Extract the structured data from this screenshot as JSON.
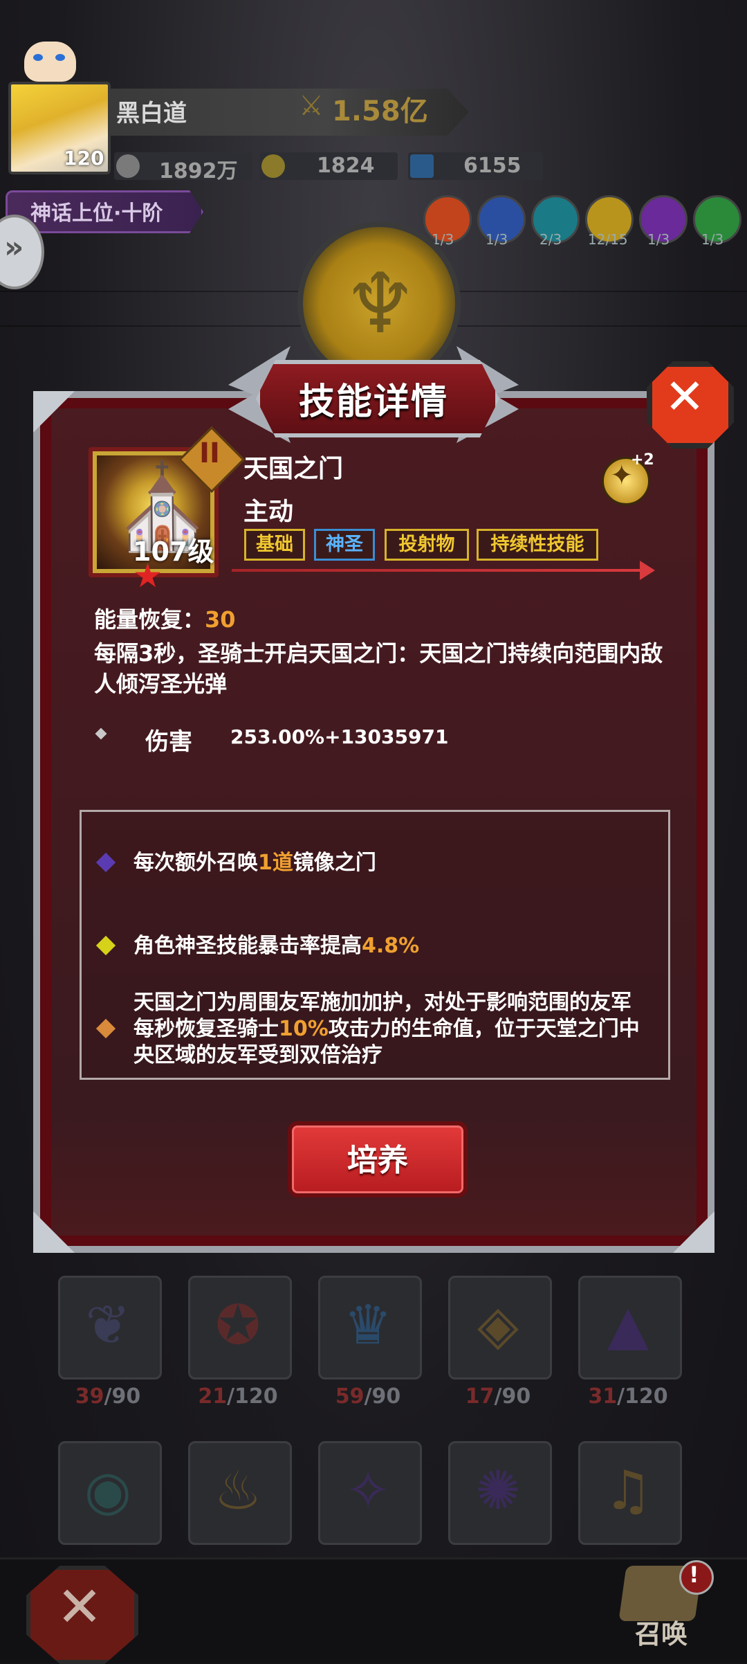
{
  "header": {
    "player_name": "黑白道",
    "power": "1.58亿",
    "level": "120",
    "resources": [
      "1892万",
      "1824",
      "6155"
    ],
    "rank_badge": "神话上位·十阶",
    "elements": [
      {
        "icon": "fire-element-icon",
        "count": "1/3",
        "color": "#c2441c"
      },
      {
        "icon": "frost-element-icon",
        "count": "1/3",
        "color": "#2b4fa0"
      },
      {
        "icon": "ice-element-icon",
        "count": "2/3",
        "color": "#1a7a86"
      },
      {
        "icon": "holy-element-icon",
        "count": "12/15",
        "color": "#b8941c"
      },
      {
        "icon": "shadow-element-icon",
        "count": "1/3",
        "color": "#6a2a9a"
      },
      {
        "icon": "nature-element-icon",
        "count": "1/3",
        "color": "#2a8a3a"
      }
    ]
  },
  "dialog": {
    "title": "技能详情",
    "skill": {
      "name": "天国之门",
      "type": "主动",
      "level": "107级",
      "rank": "II",
      "tags": [
        "基础",
        "神圣",
        "投射物",
        "持续性技能"
      ],
      "bonus_count": "+2",
      "energy_label": "能量恢复：",
      "energy_value": "30",
      "description": "每隔3秒，圣骑士开启天国之门：天国之门持续向范围内敌人倾泻圣光弹",
      "damage_label": "伤害",
      "damage_value": "253.00%+13035971"
    },
    "bonuses": [
      {
        "pre": "每次额外召唤",
        "hl": "1道",
        "post": "镜像之门",
        "color": "#5b3bb2"
      },
      {
        "pre": "角色神圣技能暴击率提高",
        "hl": "4.8%",
        "post": "",
        "color": "#d6d21a"
      },
      {
        "pre": "天国之门为周围友军施加加护，对处于影响范围的友军每秒恢复圣骑士",
        "hl": "10%",
        "post": "攻击力的生命值，位于天堂之门中央区域的友军受到双倍治疗",
        "color": "#d98a3a"
      }
    ],
    "train_button": "培养"
  },
  "grid": {
    "row1": [
      {
        "icon": "dark-wing-icon",
        "cur": "39",
        "max": "/90"
      },
      {
        "icon": "runner-icon",
        "cur": "21",
        "max": "/120"
      },
      {
        "icon": "ice-crown-icon",
        "cur": "59",
        "max": "/90"
      },
      {
        "icon": "gold-shield-icon",
        "cur": "17",
        "max": "/90"
      },
      {
        "icon": "witch-hat-icon",
        "cur": "31",
        "max": "/120"
      }
    ],
    "row2": [
      {
        "icon": "eye-icon"
      },
      {
        "icon": "flame-icon"
      },
      {
        "icon": "star-icon"
      },
      {
        "icon": "vortex-icon"
      },
      {
        "icon": "bell-icon"
      }
    ]
  },
  "bottom": {
    "summon_label": "召唤",
    "alert": "!"
  }
}
